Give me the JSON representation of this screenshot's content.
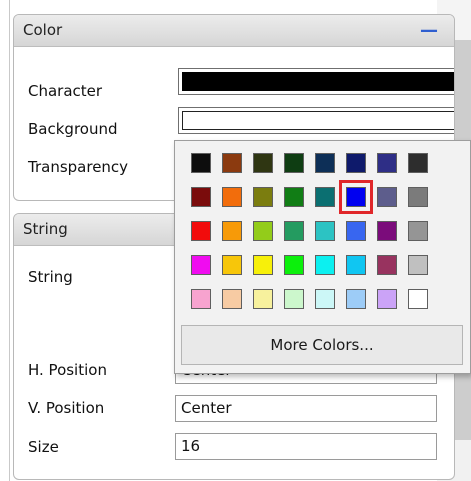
{
  "color_section": {
    "title": "Color",
    "collapse_glyph": "—",
    "character_label": "Character",
    "background_label": "Background",
    "transparency_label": "Transparency",
    "character_color": "#000000",
    "background_color": "#ffffff"
  },
  "string_section": {
    "title": "String",
    "string_label": "String",
    "h_position_label": "H. Position",
    "h_position_value": "Center",
    "v_position_label": "V. Position",
    "v_position_value": "Center",
    "size_label": "Size",
    "size_value": "16"
  },
  "color_picker": {
    "rows": [
      [
        "#0d0d0d",
        "#8b3a0f",
        "#2f3612",
        "#0e3d12",
        "#0d2f57",
        "#0e1a6b",
        "#2e2e86",
        "#2d2d2d"
      ],
      [
        "#7a0c0c",
        "#f26d0c",
        "#7b7d0f",
        "#117d15",
        "#0b6f71",
        "#0000f0",
        "#5d5d8c",
        "#7b7b7b"
      ],
      [
        "#f20c0c",
        "#f79a08",
        "#93cc1a",
        "#249b60",
        "#2cc3c3",
        "#3866f0",
        "#7b0c7b",
        "#959595"
      ],
      [
        "#f00cf0",
        "#f7c60a",
        "#f7f00a",
        "#0cf00c",
        "#0cf0f0",
        "#10c6f2",
        "#98335f",
        "#c0c0c0"
      ],
      [
        "#f7a3cf",
        "#f7cba3",
        "#f7f19d",
        "#ccf7cc",
        "#ccf7f7",
        "#9dccf7",
        "#cba3f7",
        "#ffffff"
      ]
    ],
    "selected": {
      "row": 1,
      "col": 5
    },
    "more_colors_label": "More Colors..."
  }
}
